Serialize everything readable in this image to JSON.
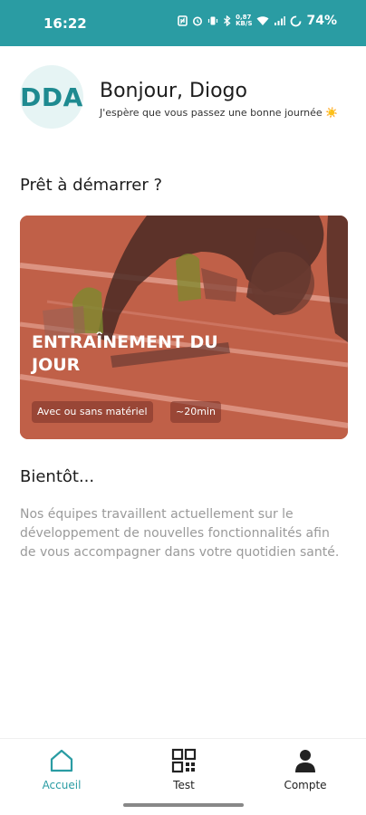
{
  "status_bar": {
    "time": "16:22",
    "net_speed_value": "0,87",
    "net_speed_unit": "KB/S",
    "battery": "74%"
  },
  "header": {
    "avatar_initials": "DDA",
    "greeting": "Bonjour, Diogo",
    "subgreeting": "J'espère que vous passez une bonne journée ☀️"
  },
  "main": {
    "ready_title": "Prêt à démarrer ?",
    "workout_card": {
      "title": "ENTRAÎNEMENT DU JOUR",
      "chip_equipment": "Avec ou sans matériel",
      "chip_duration": "~20min"
    },
    "soon_title": "Bientôt...",
    "soon_text": "Nos équipes travaillent actuellement sur le développement de nouvelles fonctionnalités afin de vous accompagner dans votre quotidien santé."
  },
  "bottom_nav": {
    "items": [
      {
        "label": "Accueil",
        "icon": "home-icon",
        "active": true
      },
      {
        "label": "Test",
        "icon": "qr-grid-icon",
        "active": false
      },
      {
        "label": "Compte",
        "icon": "person-icon",
        "active": false
      }
    ]
  },
  "colors": {
    "accent": "#2a9ca3",
    "card_tint": "#b8563f"
  }
}
